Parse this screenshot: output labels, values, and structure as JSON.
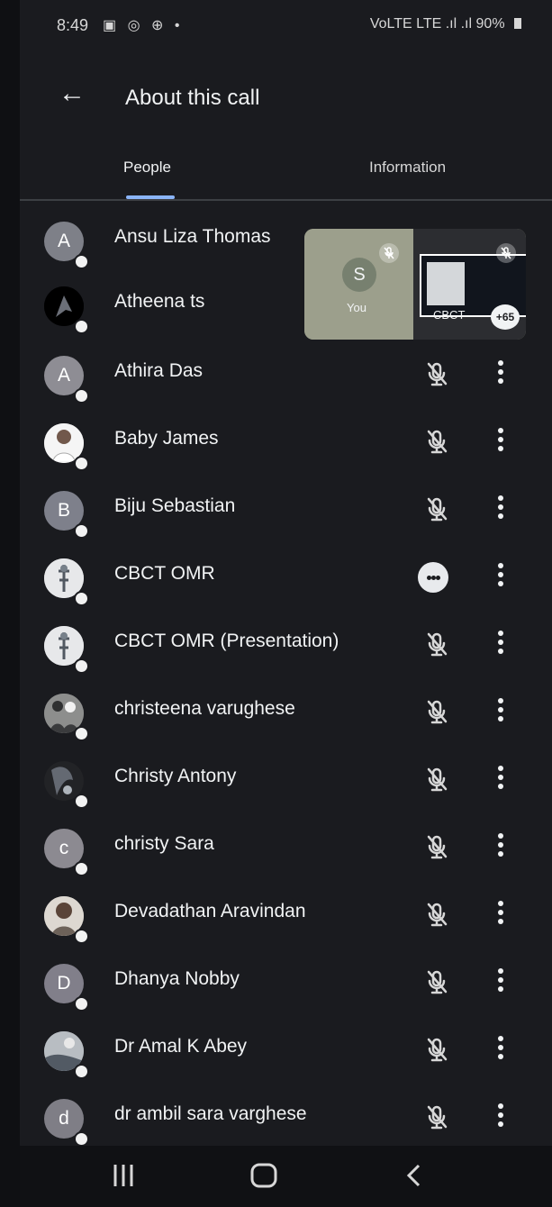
{
  "status_bar": {
    "time": "8:49",
    "left_icons": [
      "gallery-icon",
      "whatsapp-icon",
      "grid-globe-icon",
      "notification-dot-icon"
    ],
    "network_text": "VoLTE LTE",
    "signal": ".ıl .ıl",
    "battery": "90%"
  },
  "header": {
    "back_icon": "arrow-left-icon",
    "title": "About this call"
  },
  "tabs": [
    {
      "label": "People",
      "selected": true
    },
    {
      "label": "Information",
      "selected": false
    }
  ],
  "pip": {
    "self_initial": "S",
    "self_label": "You",
    "presenter_label": "CBCT",
    "more_count": "+65"
  },
  "participants": [
    {
      "name": "Ansu Liza Thomas",
      "avatar_type": "initial",
      "initial": "A",
      "avatar_color": "#7e8088",
      "status": "hidden"
    },
    {
      "name": "Atheena ts",
      "avatar_type": "photo",
      "photo": "dark-portrait",
      "avatar_color": "#000000",
      "status": "hidden"
    },
    {
      "name": "Athira Das",
      "avatar_type": "initial",
      "initial": "A",
      "avatar_color": "#8e8d94",
      "status": "muted"
    },
    {
      "name": "Baby James",
      "avatar_type": "photo",
      "photo": "man-white-shirt",
      "avatar_color": "#f4f4f4",
      "status": "muted"
    },
    {
      "name": "Biju Sebastian",
      "avatar_type": "initial",
      "initial": "B",
      "avatar_color": "#7e808b",
      "status": "muted"
    },
    {
      "name": "CBCT OMR",
      "avatar_type": "photo",
      "photo": "xray-image",
      "avatar_color": "#e6e7ea",
      "status": "speaking"
    },
    {
      "name": "CBCT OMR (Presentation)",
      "avatar_type": "photo",
      "photo": "xray-image",
      "avatar_color": "#e6e7ea",
      "status": "muted"
    },
    {
      "name": "christeena varughese",
      "avatar_type": "photo",
      "photo": "group-silhouette",
      "avatar_color": "#898a88",
      "status": "muted"
    },
    {
      "name": "Christy Antony",
      "avatar_type": "photo",
      "photo": "dark-figure",
      "avatar_color": "#1d1d20",
      "status": "muted"
    },
    {
      "name": "christy Sara",
      "avatar_type": "initial",
      "initial": "c",
      "avatar_color": "#8c8a91",
      "status": "muted"
    },
    {
      "name": "Devadathan Aravindan",
      "avatar_type": "photo",
      "photo": "man-portrait",
      "avatar_color": "#d9d4cf",
      "status": "muted"
    },
    {
      "name": "Dhanya Nobby",
      "avatar_type": "initial",
      "initial": "D",
      "avatar_color": "#817f8a",
      "status": "muted"
    },
    {
      "name": "Dr Amal K Abey",
      "avatar_type": "photo",
      "photo": "landscape-person",
      "avatar_color": "#b8bbc0",
      "status": "muted"
    },
    {
      "name": "dr ambil sara varghese",
      "avatar_type": "initial",
      "initial": "d",
      "avatar_color": "#7f7e86",
      "status": "muted"
    }
  ],
  "nav_bar": {
    "items": [
      "recent-apps-icon",
      "home-icon",
      "system-back-icon"
    ]
  },
  "colors": {
    "background": "#1a1b1f",
    "text": "#e8eaed",
    "accent": "#8ab4f8",
    "nav": "#101114"
  }
}
